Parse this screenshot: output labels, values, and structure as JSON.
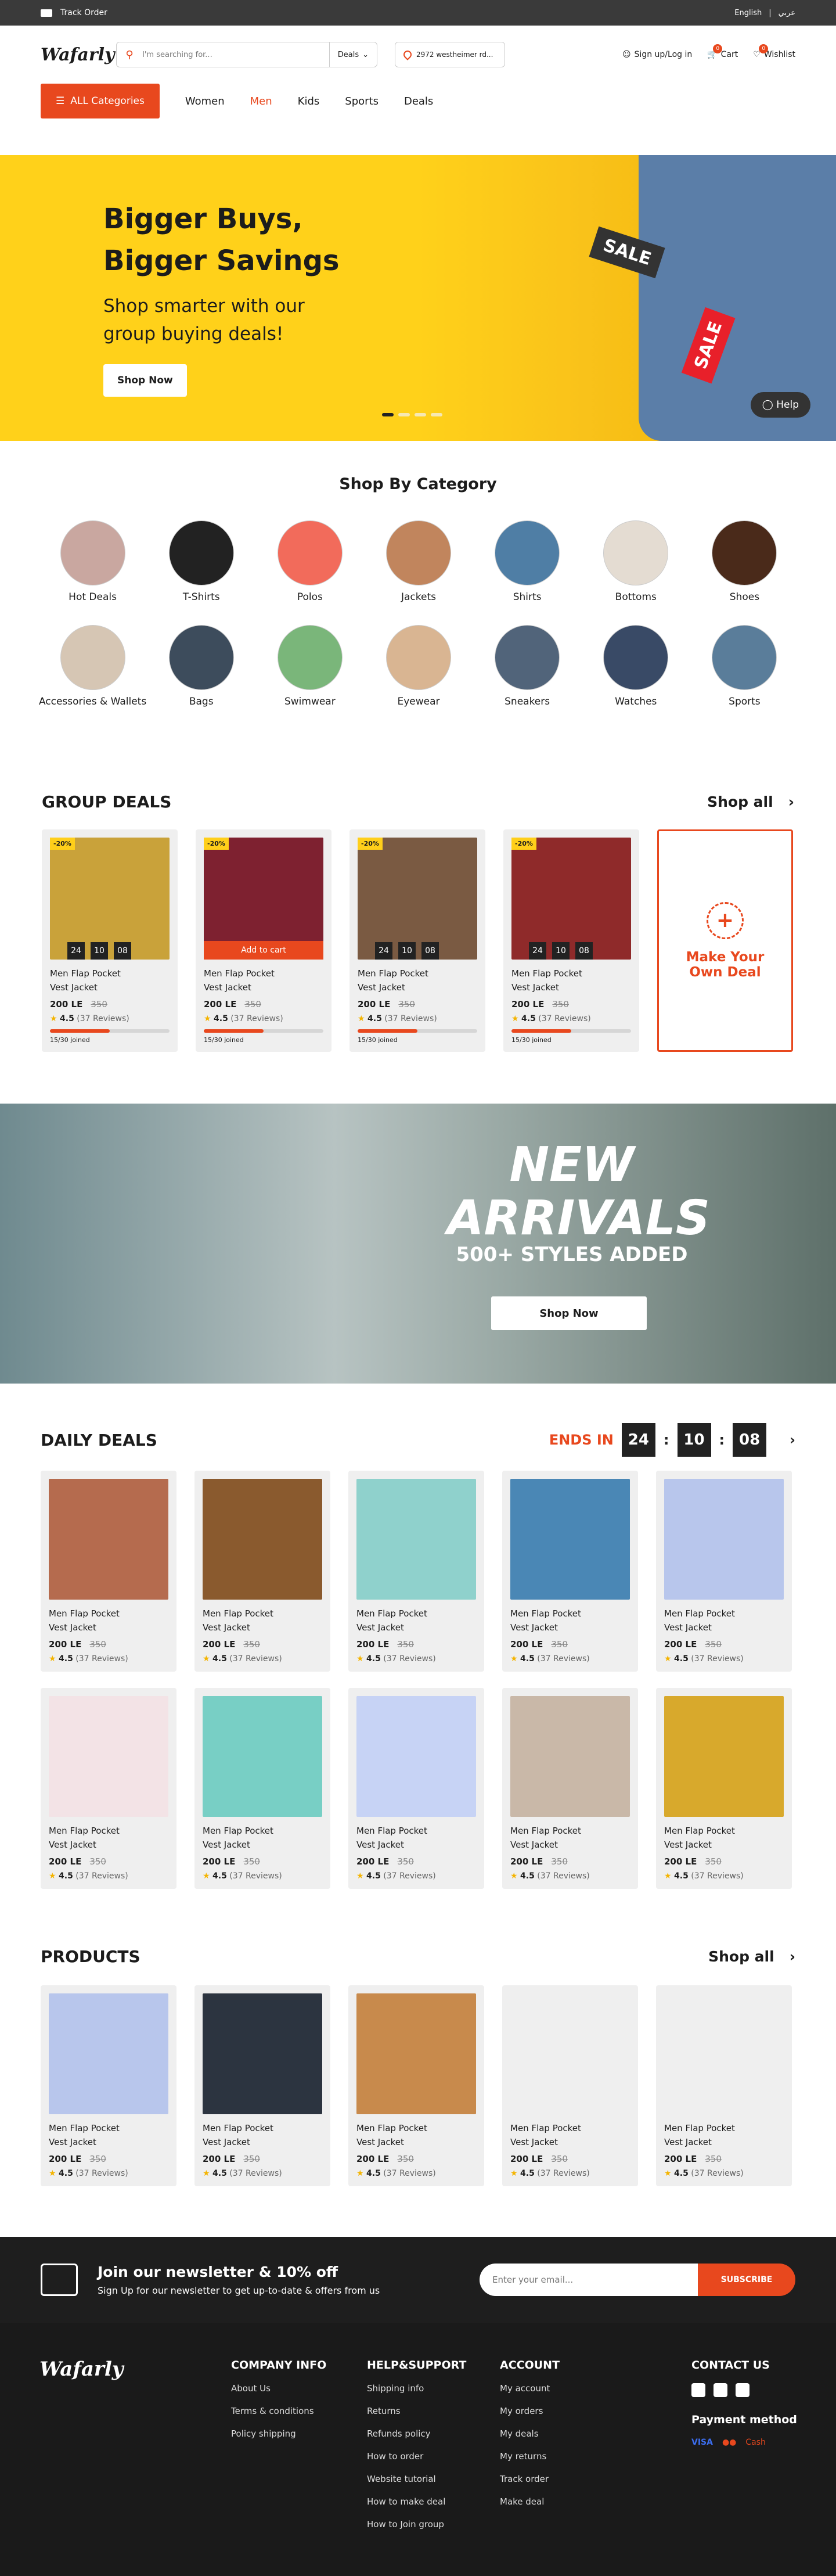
{
  "topbar": {
    "track_order": "Track Order",
    "lang_en": "English",
    "lang_sep": "|",
    "lang_ar": "عربي"
  },
  "header": {
    "logo": "Wafarly",
    "search_placeholder": "I'm searching for...",
    "search_scope": "Deals",
    "location": "2972 westheimer rd...",
    "signup": "Sign up/Log in",
    "cart": "Cart",
    "cart_count": "0",
    "wishlist": "Wishlist",
    "wishlist_count": "0"
  },
  "nav": {
    "all_categories": "ALL Categories",
    "items": [
      "Women",
      "Men",
      "Kids",
      "Sports",
      "Deals"
    ],
    "active": "Men"
  },
  "hero": {
    "title_line1": "Bigger Buys,",
    "title_line2": "Bigger Savings",
    "subtitle_line1": "Shop smarter with our",
    "subtitle_line2": "group buying deals!",
    "cta": "Shop Now",
    "tag1": "SALE",
    "tag2": "SALE",
    "help": "Help",
    "slide_count": 4,
    "active_slide": 0
  },
  "categories": {
    "title": "Shop By Category",
    "items": [
      "Hot Deals",
      "T-Shirts",
      "Polos",
      "Jackets",
      "Shirts",
      "Bottoms",
      "Shoes",
      "Accessories & Wallets",
      "Bags",
      "Swimwear",
      "Eyewear",
      "Sneakers",
      "Watches",
      "Sports"
    ]
  },
  "group_deals": {
    "title": "GROUP DEALS",
    "shop_all": "Shop all",
    "make_deal_line1": "Make Your",
    "make_deal_line2": "Own Deal",
    "cards": [
      {
        "discount": "-20%",
        "title_line1": "Men Flap Pocket",
        "title_line2": "Vest Jacket",
        "price": "200 LE",
        "old_price": "350",
        "rating": "4.5",
        "reviews": "(37 Reviews)",
        "joined": "15/30 joined",
        "timer": [
          "24",
          "10",
          "08"
        ],
        "color": "#c9a23a"
      },
      {
        "discount": "-20%",
        "title_line1": "Men Flap Pocket",
        "title_line2": "Vest Jacket",
        "price": "200 LE",
        "old_price": "350",
        "rating": "4.5",
        "reviews": "(37 Reviews)",
        "joined": "15/30 joined",
        "add_to_cart": "Add to cart",
        "color": "#7e2130"
      },
      {
        "discount": "-20%",
        "title_line1": "Men Flap Pocket",
        "title_line2": "Vest Jacket",
        "price": "200 LE",
        "old_price": "350",
        "rating": "4.5",
        "reviews": "(37 Reviews)",
        "joined": "15/30 joined",
        "timer": [
          "24",
          "10",
          "08"
        ],
        "color": "#7a5a42"
      },
      {
        "discount": "-20%",
        "title_line1": "Men Flap Pocket",
        "title_line2": "Vest Jacket",
        "price": "200 LE",
        "old_price": "350",
        "rating": "4.5",
        "reviews": "(37 Reviews)",
        "joined": "15/30 joined",
        "timer": [
          "24",
          "10",
          "08"
        ],
        "color": "#8f2a2a"
      }
    ]
  },
  "arrivals": {
    "title_line1": "NEW",
    "title_line2": "ARRIVALS",
    "subtitle": "500+ STYLES ADDED",
    "cta": "Shop Now"
  },
  "daily_deals": {
    "title": "DAILY DEALS",
    "ends_in": "ENDS IN",
    "hours": "24",
    "minutes": "10",
    "seconds": "08",
    "cards": [
      {
        "title_line1": "Men Flap Pocket",
        "title_line2": "Vest Jacket",
        "price": "200 LE",
        "old_price": "350",
        "rating": "4.5",
        "reviews": "(37 Reviews)",
        "color": "#b56b4e"
      },
      {
        "title_line1": "Men Flap Pocket",
        "title_line2": "Vest Jacket",
        "price": "200 LE",
        "old_price": "350",
        "rating": "4.5",
        "reviews": "(37 Reviews)",
        "color": "#8a5a2e"
      },
      {
        "title_line1": "Men Flap Pocket",
        "title_line2": "Vest Jacket",
        "price": "200 LE",
        "old_price": "350",
        "rating": "4.5",
        "reviews": "(37 Reviews)",
        "color": "#8fd1cc"
      },
      {
        "title_line1": "Men Flap Pocket",
        "title_line2": "Vest Jacket",
        "price": "200 LE",
        "old_price": "350",
        "rating": "4.5",
        "reviews": "(37 Reviews)",
        "color": "#4a87b5"
      },
      {
        "title_line1": "Men Flap Pocket",
        "title_line2": "Vest Jacket",
        "price": "200 LE",
        "old_price": "350",
        "rating": "4.5",
        "reviews": "(37 Reviews)",
        "color": "#b8c6ec"
      },
      {
        "title_line1": "Men Flap Pocket",
        "title_line2": "Vest Jacket",
        "price": "200 LE",
        "old_price": "350",
        "rating": "4.5",
        "reviews": "(37 Reviews)",
        "color": "#f3e3e6"
      },
      {
        "title_line1": "Men Flap Pocket",
        "title_line2": "Vest Jacket",
        "price": "200 LE",
        "old_price": "350",
        "rating": "4.5",
        "reviews": "(37 Reviews)",
        "color": "#78cfc5"
      },
      {
        "title_line1": "Men Flap Pocket",
        "title_line2": "Vest Jacket",
        "price": "200 LE",
        "old_price": "350",
        "rating": "4.5",
        "reviews": "(37 Reviews)",
        "color": "#c7d3f5"
      },
      {
        "title_line1": "Men Flap Pocket",
        "title_line2": "Vest Jacket",
        "price": "200 LE",
        "old_price": "350",
        "rating": "4.5",
        "reviews": "(37 Reviews)",
        "color": "#c9b8a8"
      },
      {
        "title_line1": "Men Flap Pocket",
        "title_line2": "Vest Jacket",
        "price": "200 LE",
        "old_price": "350",
        "rating": "4.5",
        "reviews": "(37 Reviews)",
        "color": "#d8a92c"
      }
    ]
  },
  "products": {
    "title": "PRODUCTS",
    "shop_all": "Shop all",
    "cards": [
      {
        "title_line1": "Men Flap Pocket",
        "title_line2": "Vest Jacket",
        "price": "200 LE",
        "old_price": "350",
        "rating": "4.5",
        "reviews": "(37 Reviews)",
        "color": "#b8c6ec"
      },
      {
        "title_line1": "Men Flap Pocket",
        "title_line2": "Vest Jacket",
        "price": "200 LE",
        "old_price": "350",
        "rating": "4.5",
        "reviews": "(37 Reviews)",
        "color": "#2c3440"
      },
      {
        "title_line1": "Men Flap Pocket",
        "title_line2": "Vest Jacket",
        "price": "200 LE",
        "old_price": "350",
        "rating": "4.5",
        "reviews": "(37 Reviews)",
        "color": "#c88a4c"
      },
      {
        "title_line1": "Men Flap Pocket",
        "title_line2": "Vest Jacket",
        "price": "200 LE",
        "old_price": "350",
        "rating": "4.5",
        "reviews": "(37 Reviews)",
        "color": ""
      },
      {
        "title_line1": "Men Flap Pocket",
        "title_line2": "Vest Jacket",
        "price": "200 LE",
        "old_price": "350",
        "rating": "4.5",
        "reviews": "(37 Reviews)",
        "color": ""
      }
    ]
  },
  "newsletter": {
    "title": "Join our newsletter & 10% off",
    "subtitle": "Sign Up for our newsletter to get up-to-date & offers from us",
    "placeholder": "Enter your email...",
    "subscribe": "SUBSCRIBE"
  },
  "footer": {
    "logo": "Wafarly",
    "company": {
      "title": "COMPANY INFO",
      "links": [
        "About Us",
        "Terms & conditions",
        "Policy shipping"
      ]
    },
    "help": {
      "title": "HELP&SUPPORT",
      "links": [
        "Shipping info",
        "Returns",
        "Refunds policy",
        "How to order",
        "Website tutorial",
        "How to make deal",
        "How to Join group"
      ]
    },
    "account": {
      "title": "ACCOUNT",
      "links": [
        "My account",
        "My orders",
        "My deals",
        "My returns",
        "Track order",
        "Make deal"
      ]
    },
    "contact": {
      "title": "CONTACT US"
    },
    "payment": {
      "title": "Payment method",
      "visa": "VISA",
      "cash": "Cash"
    }
  },
  "colors": {
    "accent": "#e8481e",
    "hero_yellow": "#ffd11a",
    "dark": "#1e1e1e"
  }
}
